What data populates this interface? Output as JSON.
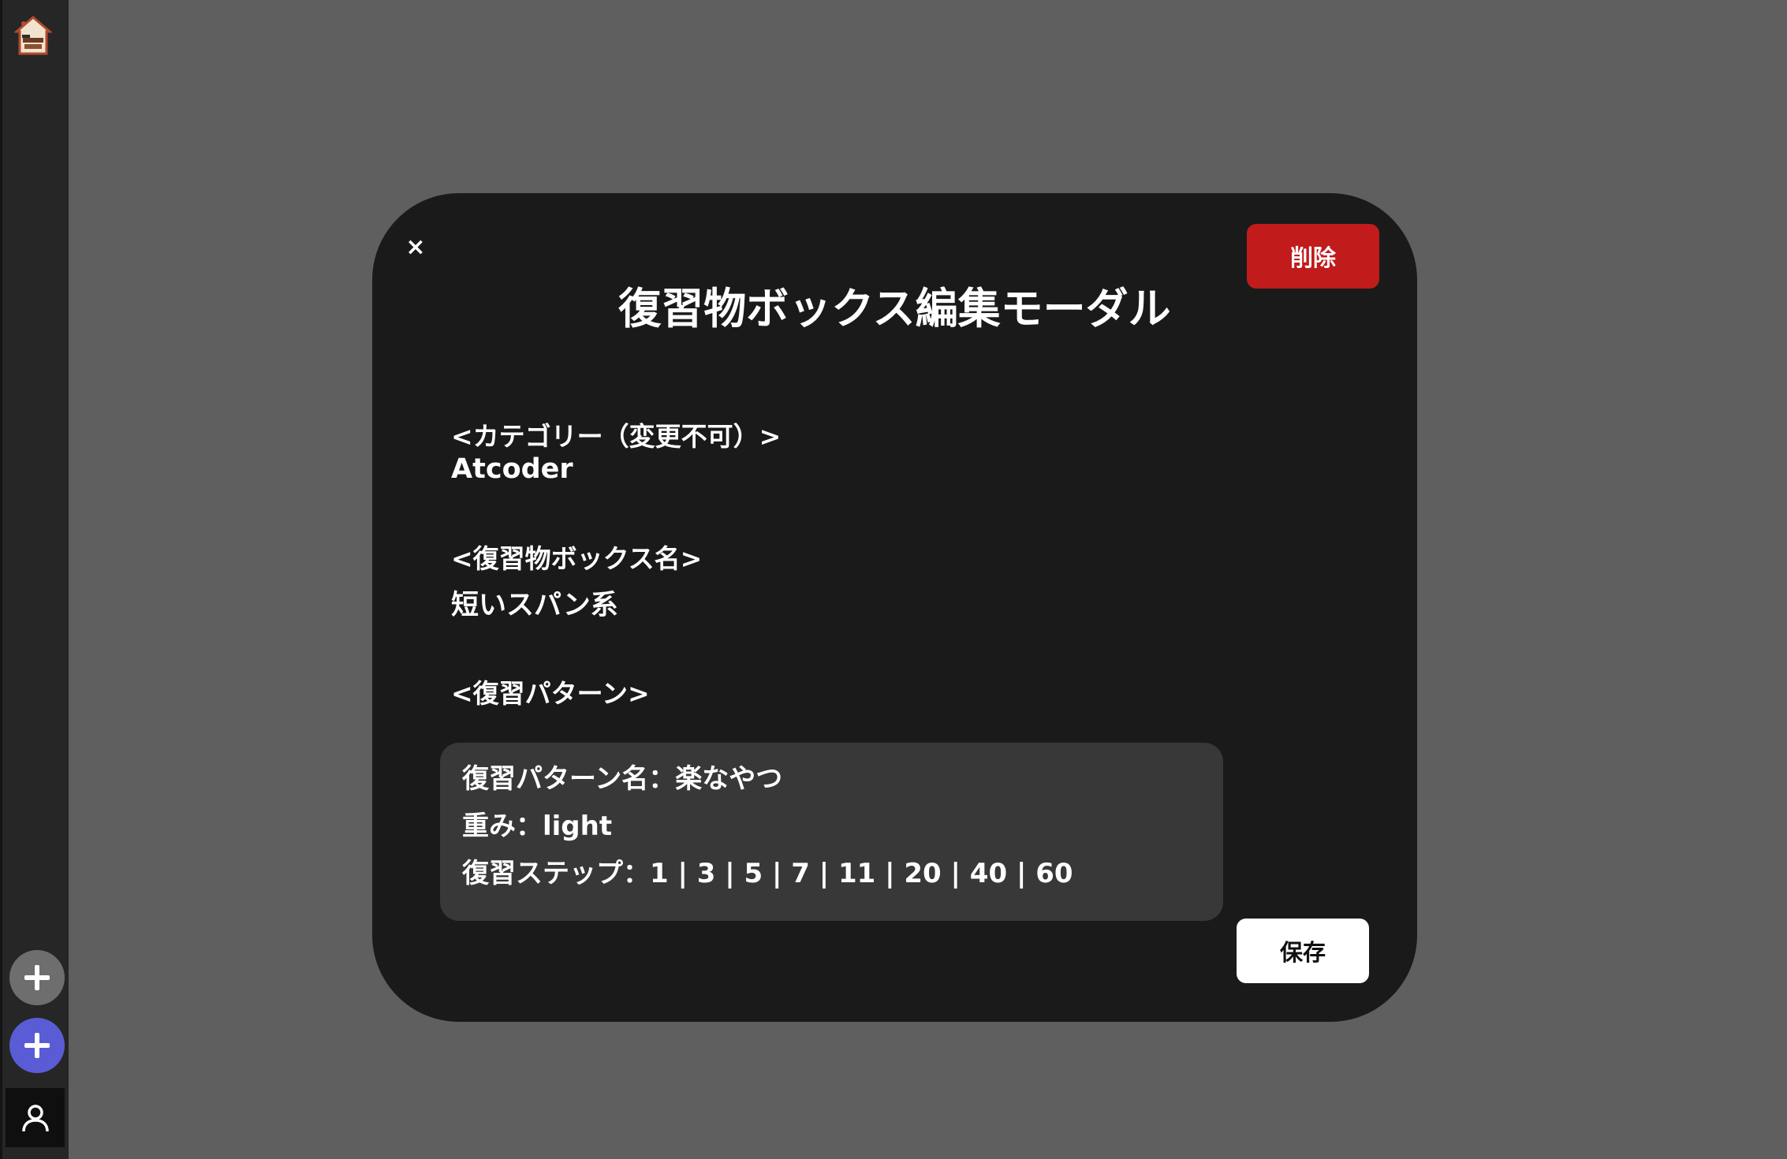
{
  "app": {
    "logo_icon": "house-icon"
  },
  "sidebar": {
    "buttons": [
      {
        "name": "add-button-gray",
        "icon": "plus-icon",
        "color": "#6e6e6e"
      },
      {
        "name": "add-button-blue",
        "icon": "plus-icon",
        "color": "#5a5cd6"
      }
    ],
    "user_icon": "user-icon"
  },
  "modal": {
    "title": "復習物ボックス編集モーダル",
    "close_label": "×",
    "delete_label": "削除",
    "delete_color": "#c11b1b",
    "save_label": "保存",
    "category_label": "<カテゴリー（変更不可）>",
    "category_value": "Atcoder",
    "box_name_label": "<復習物ボックス名>",
    "box_name_value": "短いスパン系",
    "pattern_label": "<復習パターン>",
    "pattern": {
      "name_line": "復習パターン名：楽なやつ",
      "weight_line": "重み：light",
      "steps_line": "復習ステップ：1 | 3 | 5 | 7 | 11 | 20 | 40 | 60"
    }
  }
}
